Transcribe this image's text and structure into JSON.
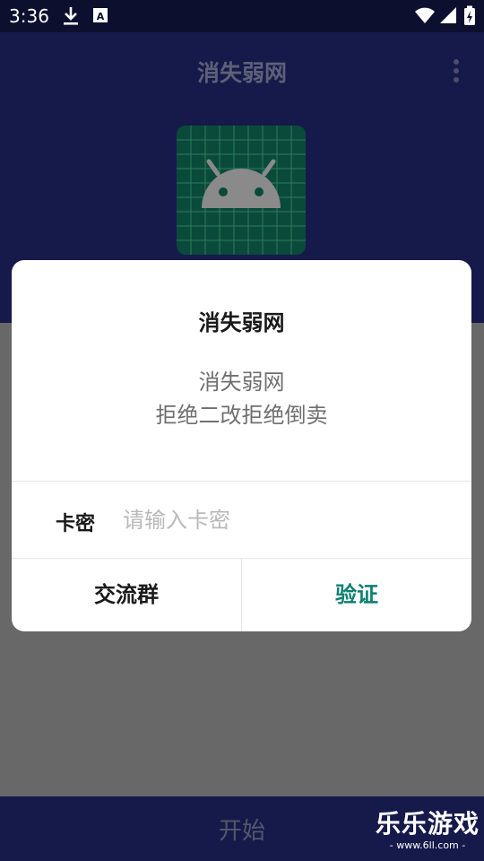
{
  "status_bar": {
    "time": "3:36",
    "icons": [
      "download-icon",
      "a-box-icon",
      "wifi-icon",
      "signal-icon",
      "battery-charging-icon"
    ]
  },
  "app_bar": {
    "title": "消失弱网",
    "menu_icon": "more-vert-icon"
  },
  "logo": {
    "icon": "android-icon",
    "colors": {
      "tile": "#0a4a3a",
      "grid": "#2f7a60",
      "robot": "#8a8a8a"
    }
  },
  "dialog": {
    "title": "消失弱网",
    "message_line1": "消失弱网",
    "message_line2": "拒绝二改拒绝倒卖",
    "card_label": "卡密",
    "card_value": "",
    "card_placeholder": "请输入卡密",
    "left_button": "交流群",
    "right_button": "验证"
  },
  "bottom_bar": {
    "start_label": "开始"
  },
  "watermark": {
    "brand": "乐乐游戏",
    "url": "- www.6ll.com -"
  },
  "colors": {
    "primary_dark": "#151a4a",
    "accent": "#0b7f73"
  }
}
